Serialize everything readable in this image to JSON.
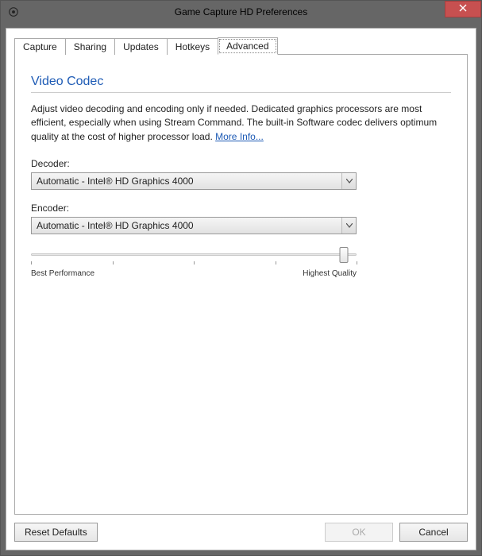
{
  "window": {
    "title": "Game Capture HD Preferences"
  },
  "tabs": [
    {
      "label": "Capture"
    },
    {
      "label": "Sharing"
    },
    {
      "label": "Updates"
    },
    {
      "label": "Hotkeys"
    },
    {
      "label": "Advanced",
      "active": true
    }
  ],
  "section": {
    "title": "Video Codec",
    "desc_part_1": "Adjust video decoding and encoding only if needed. Dedicated graphics processors are most efficient, especially when using Stream Command. The built-in Software codec delivers optimum quality at the cost of higher processor load. ",
    "more_info": "More Info..."
  },
  "decoder": {
    "label": "Decoder:",
    "value": "Automatic - Intel® HD Graphics 4000"
  },
  "encoder": {
    "label": "Encoder:",
    "value": "Automatic - Intel® HD Graphics 4000"
  },
  "slider": {
    "min_label": "Best Performance",
    "max_label": "Highest Quality",
    "value_percent": 96
  },
  "footer": {
    "reset_label": "Reset Defaults",
    "ok_label": "OK",
    "cancel_label": "Cancel"
  }
}
